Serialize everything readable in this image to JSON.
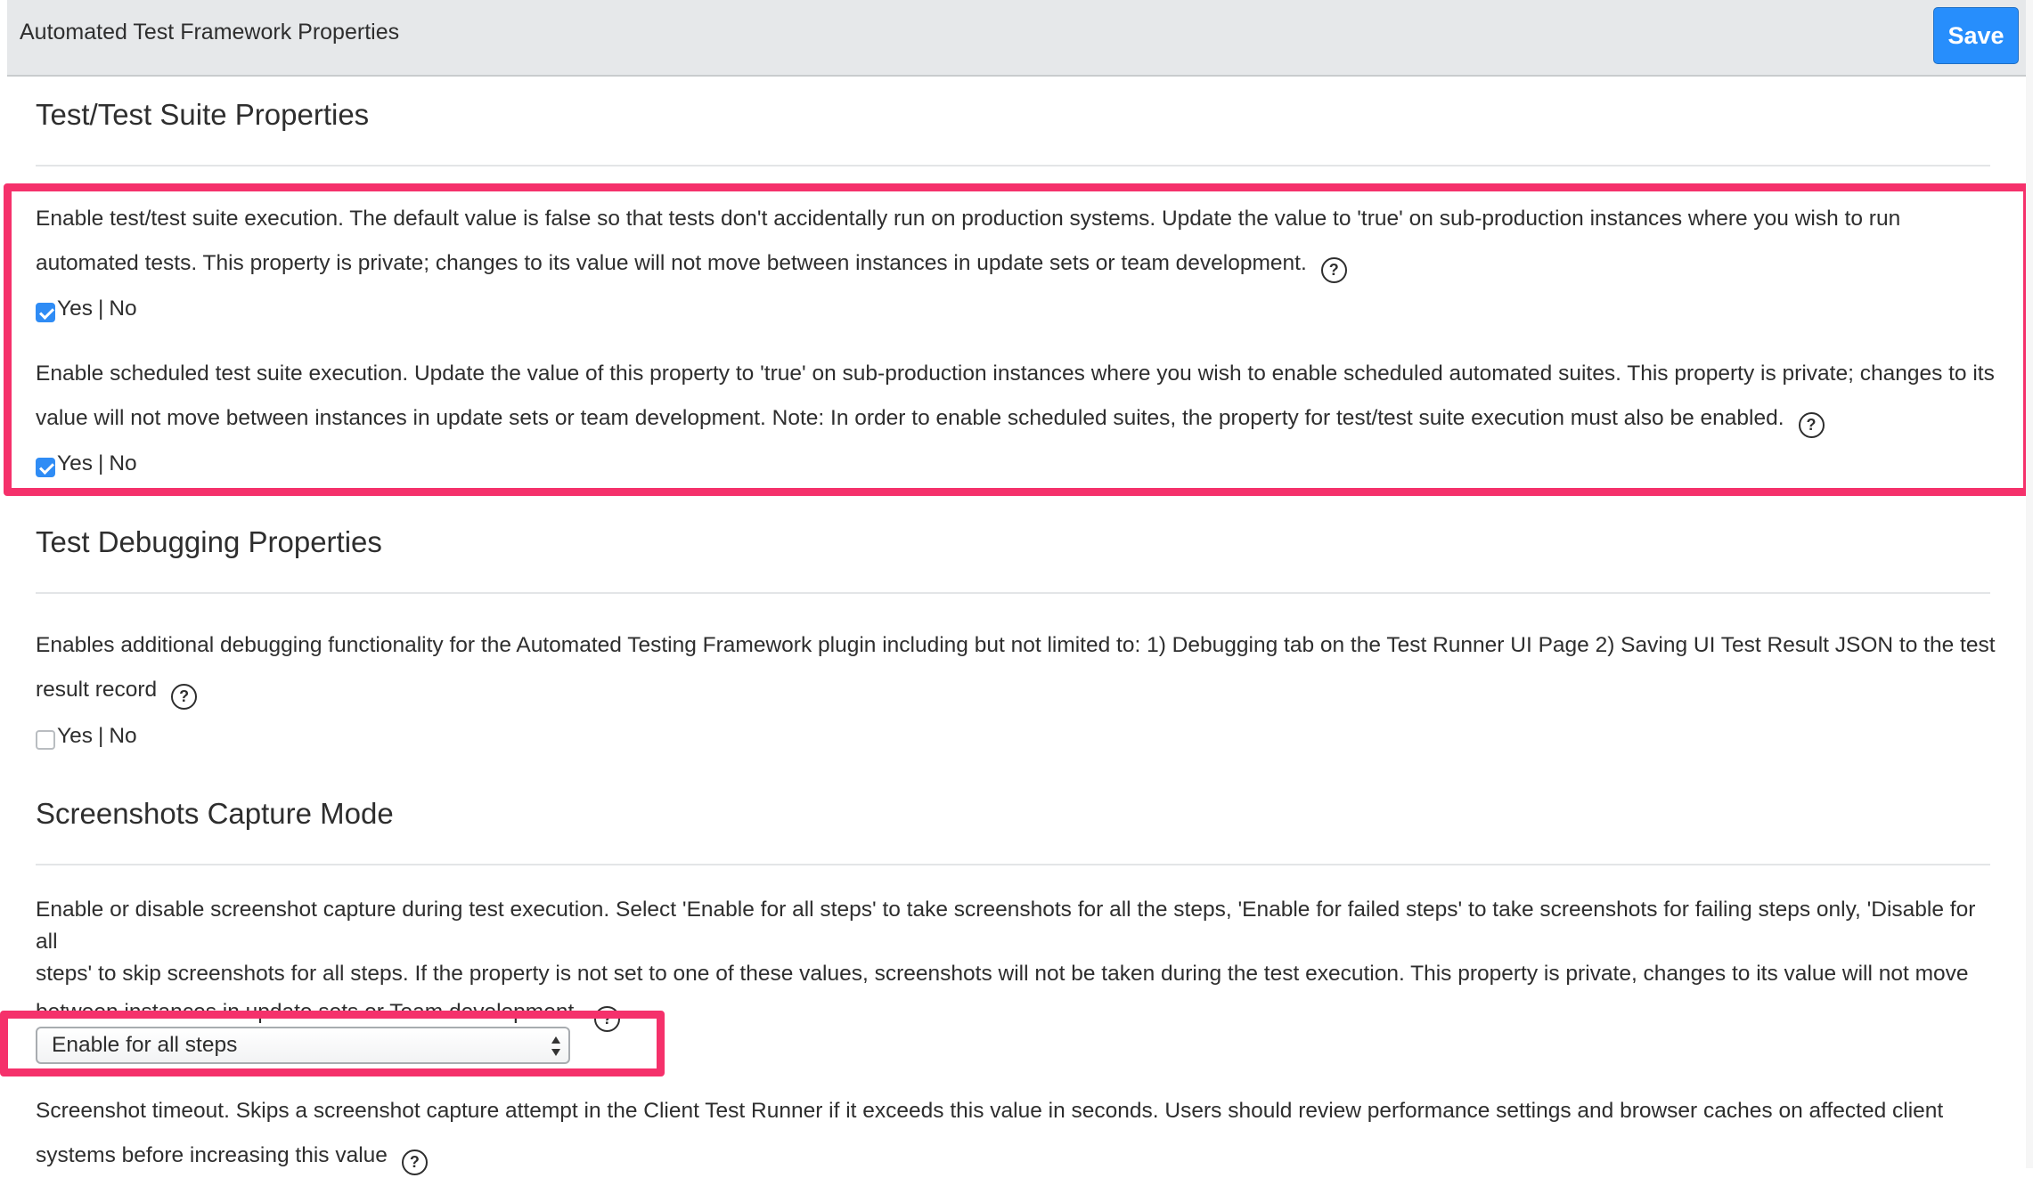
{
  "header": {
    "title": "Automated Test Framework Properties",
    "save_label": "Save"
  },
  "sections": {
    "suite": {
      "title": "Test/Test Suite Properties",
      "prop1": {
        "line1": "Enable test/test suite execution. The default value is false so that tests don't accidentally run on production systems. Update the value to 'true' on sub-production instances where you wish to run",
        "line2": "automated tests. This property is private; changes to its value will not move between instances in update sets or team development.",
        "checked": true,
        "yes": "Yes",
        "sep": "|",
        "no": "No"
      },
      "prop2": {
        "line1": "Enable scheduled test suite execution. Update the value of this property to 'true' on sub-production instances where you wish to enable scheduled automated suites. This property is private; changes to its",
        "line2": "value will not move between instances in update sets or team development. Note: In order to enable scheduled suites, the property for test/test suite execution must also be enabled.",
        "checked": true,
        "yes": "Yes",
        "sep": "|",
        "no": "No"
      }
    },
    "debugging": {
      "title": "Test Debugging Properties",
      "prop1": {
        "line1": "Enables additional debugging functionality for the Automated Testing Framework plugin including but not limited to: 1) Debugging tab on the Test Runner UI Page 2) Saving UI Test Result JSON to the test",
        "line2": "result record",
        "checked": false,
        "yes": "Yes",
        "sep": "|",
        "no": "No"
      }
    },
    "screenshots": {
      "title": "Screenshots Capture Mode",
      "prop1": {
        "line1": "Enable or disable screenshot capture during test execution. Select 'Enable for all steps' to take screenshots for all the steps, 'Enable for failed steps' to take screenshots for failing steps only, 'Disable for all",
        "line2": "steps' to skip screenshots for all steps. If the property is not set to one of these values, screenshots will not be taken during the test execution. This property is private, changes to its value will not move",
        "line3": "between instances in update sets or Team development.",
        "selected_value": "Enable for all steps"
      },
      "prop2": {
        "line1": "Screenshot timeout. Skips a screenshot capture attempt in the Client Test Runner if it exceeds this value in seconds. Users should review performance settings and browser caches on affected client",
        "line2": "systems before increasing this value"
      }
    }
  },
  "help_icon_glyph": "?",
  "colors": {
    "save_button": "#278efc",
    "highlight": "#f5316b",
    "checkbox_checked": "#2f8cf5"
  }
}
